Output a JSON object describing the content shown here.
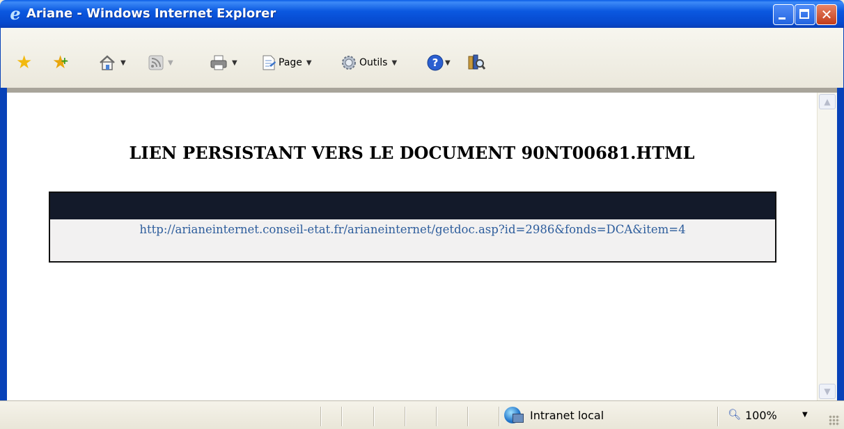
{
  "window": {
    "title": "Ariane - Windows Internet Explorer",
    "close_glyph": "✕"
  },
  "toolbar": {
    "page_label": "Page",
    "tools_label": "Outils"
  },
  "content": {
    "heading": "LIEN PERSISTANT VERS LE DOCUMENT 90NT00681.HTML",
    "link_url": "http://arianeinternet.conseil-etat.fr/arianeinternet/getdoc.asp?id=2986&fonds=DCA&item=4"
  },
  "statusbar": {
    "zone_label": "Intranet local",
    "zoom_label": "100%"
  },
  "colors": {
    "link": "#2d5d9c",
    "table_header": "#131a2a",
    "title_bar": "#0b58e0"
  }
}
